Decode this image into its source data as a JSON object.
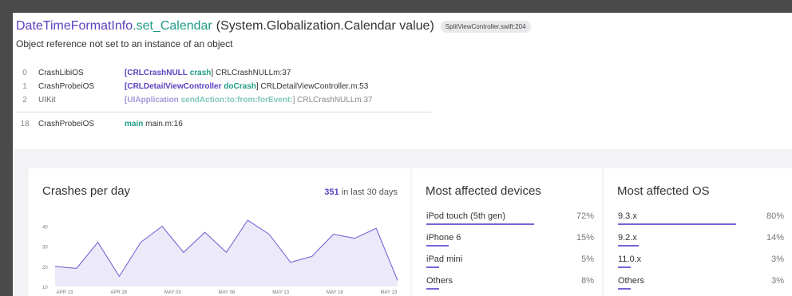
{
  "header": {
    "class_name": "DateTimeFormatInfo",
    "method_name": ".set_Calendar",
    "signature": "(System.Globalization.Calendar value)",
    "source_badge": "SplitViewController.swift:204",
    "message": "Object reference not set to an instance of an object"
  },
  "stack_frames": [
    {
      "num": "0",
      "lib": "CrashLibiOS",
      "open": "[",
      "cls": "CRLCrashNULL",
      "meth": "crash",
      "close": "]",
      "file": "CRLCrashNULLm:37",
      "dim": false
    },
    {
      "num": "1",
      "lib": "CrashProbeiOS",
      "open": "[",
      "cls": "CRLDetailViewController",
      "meth": "doCrash",
      "close": "]",
      "file": "CRLDetailViewController.m:53",
      "dim": false
    },
    {
      "num": "2",
      "lib": "UIKit",
      "open": "[",
      "cls": "UIApplication",
      "meth": "sendAction:to:from:forEvent:",
      "close": "]",
      "file": "CRLCrashNULLm:37",
      "dim": true
    }
  ],
  "main_frame": {
    "num": "18",
    "lib": "CrashProbeiOS",
    "meth": "main",
    "file": "main.m:16"
  },
  "crashes_panel": {
    "title": "Crashes per day",
    "count": "351",
    "count_suffix": "in last 30 days",
    "line_color": "#7b63d6",
    "fill_color": "#ece9f8"
  },
  "chart_data": {
    "type": "area",
    "ylim": [
      10,
      45
    ],
    "yticks": [
      "10",
      "20",
      "30",
      "40"
    ],
    "xticks": [
      "APR 23",
      "APR 28",
      "MAY 03",
      "MAY 08",
      "MAY 13",
      "MAY 18",
      "MAY 23"
    ],
    "values": [
      20,
      19,
      32,
      15,
      32,
      40,
      27,
      37,
      27,
      43,
      36,
      22,
      25,
      36,
      34,
      39,
      13
    ]
  },
  "devices_panel": {
    "title": "Most affected devices",
    "items": [
      {
        "label": "iPod touch (5th gen)",
        "pct": "72%",
        "value": 72
      },
      {
        "label": "iPhone 6",
        "pct": "15%",
        "value": 15
      },
      {
        "label": "iPad mini",
        "pct": "5%",
        "value": 5
      },
      {
        "label": "Others",
        "pct": "8%",
        "value": 8
      }
    ]
  },
  "os_panel": {
    "title": "Most affected OS",
    "items": [
      {
        "label": "9.3.x",
        "pct": "80%",
        "value": 80
      },
      {
        "label": "9.2.x",
        "pct": "14%",
        "value": 14
      },
      {
        "label": "11.0.x",
        "pct": "3%",
        "value": 3
      },
      {
        "label": "Others",
        "pct": "3%",
        "value": 3
      }
    ]
  }
}
